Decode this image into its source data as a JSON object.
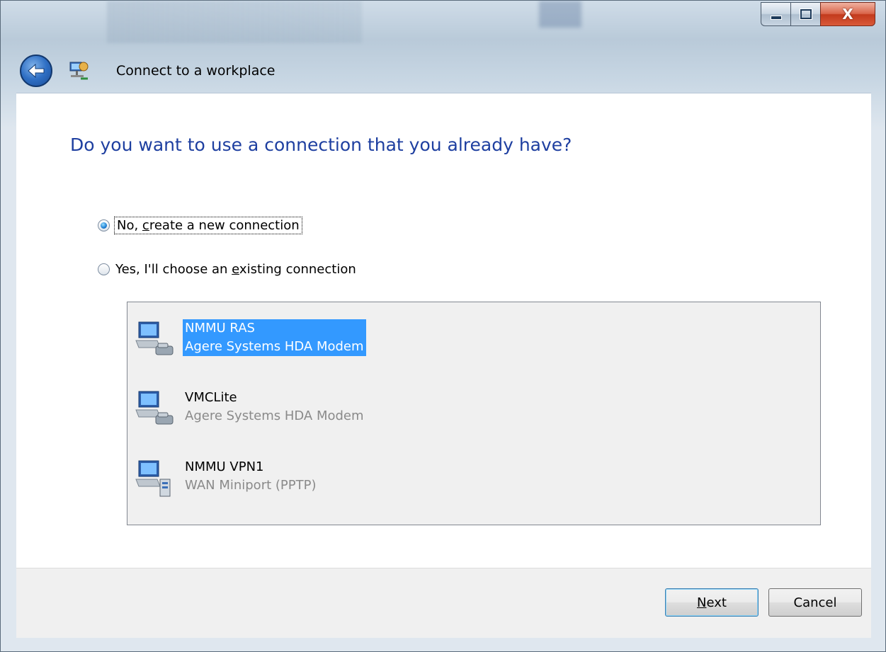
{
  "window": {
    "title": "Connect to a workplace",
    "caption_buttons": {
      "close_glyph": "X"
    }
  },
  "page": {
    "heading": "Do you want to use a connection that you already have?",
    "options": [
      {
        "pre": "No, ",
        "key": "c",
        "post": "reate a new connection",
        "checked": true
      },
      {
        "pre": "Yes, I'll choose an ",
        "key": "e",
        "post": "xisting connection",
        "checked": false
      }
    ],
    "connections": [
      {
        "name": "NMMU RAS",
        "device": "Agere Systems HDA Modem",
        "selected": true,
        "icon": "dialup-connection-icon"
      },
      {
        "name": "VMCLite",
        "device": "Agere Systems HDA Modem",
        "selected": false,
        "icon": "dialup-connection-icon"
      },
      {
        "name": "NMMU VPN1",
        "device": "WAN Miniport (PPTP)",
        "selected": false,
        "icon": "vpn-connection-icon"
      }
    ]
  },
  "footer": {
    "next": {
      "key": "N",
      "rest": "ext"
    },
    "cancel_label": "Cancel"
  },
  "colors": {
    "heading": "#1e3fa0",
    "selection": "#3399ff"
  }
}
